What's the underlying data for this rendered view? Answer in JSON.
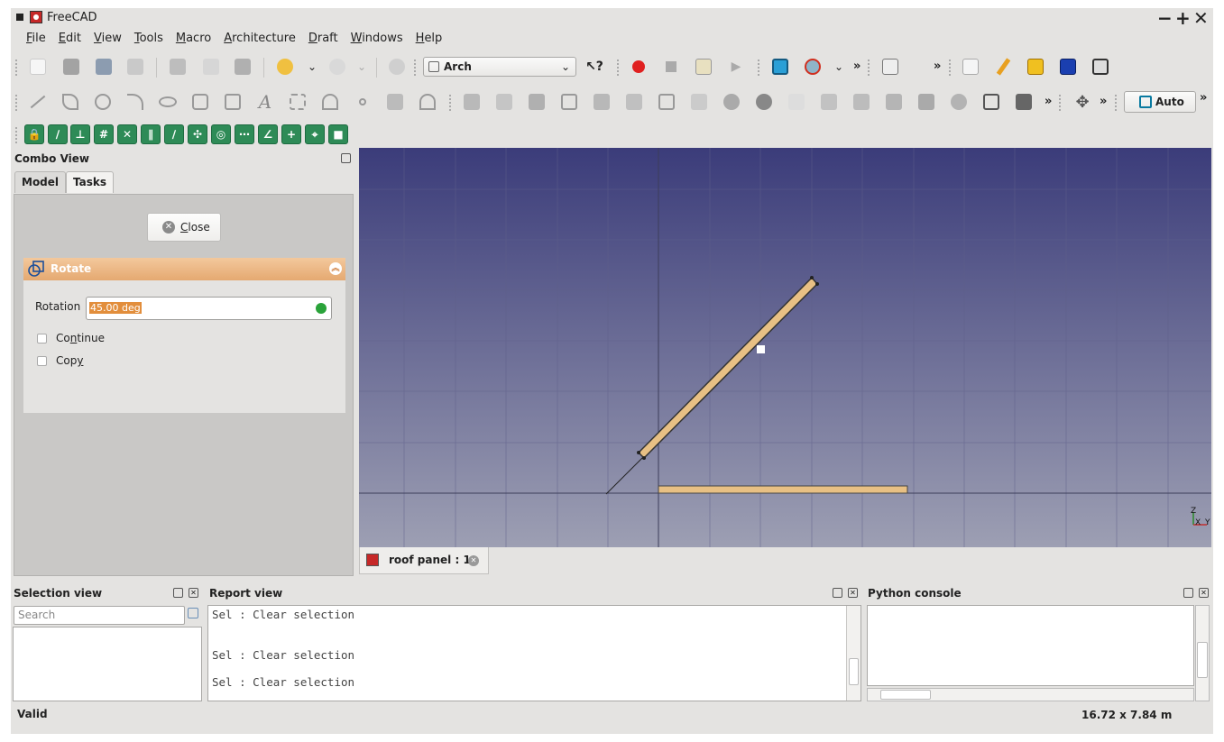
{
  "window": {
    "title": "FreeCAD",
    "controls": [
      "−",
      "+",
      "✕"
    ]
  },
  "menubar": [
    {
      "label": "File",
      "u": "F",
      "rest": "ile"
    },
    {
      "label": "Edit",
      "u": "E",
      "rest": "dit"
    },
    {
      "label": "View",
      "u": "V",
      "rest": "iew"
    },
    {
      "label": "Tools",
      "u": "T",
      "rest": "ools"
    },
    {
      "label": "Macro",
      "u": "M",
      "rest": "acro"
    },
    {
      "label": "Architecture",
      "u": "A",
      "rest": "rchitecture"
    },
    {
      "label": "Draft",
      "u": "D",
      "rest": "raft"
    },
    {
      "label": "Windows",
      "u": "W",
      "rest": "indows"
    },
    {
      "label": "Help",
      "u": "H",
      "rest": "elp"
    }
  ],
  "toolbar": {
    "workbench": "Arch",
    "workbench_arrow": "⌄",
    "auto_label": "Auto",
    "overflow": "»"
  },
  "combo_view": {
    "title": "Combo View",
    "tabs": [
      {
        "label": "Model",
        "active": false
      },
      {
        "label": "Tasks",
        "active": true
      }
    ],
    "close_label": "Close",
    "close_mnemonic": "C",
    "close_rest": "lose"
  },
  "rotate_panel": {
    "title": "Rotate",
    "rotation_label": "Rotation",
    "rotation_value": "45.00 deg",
    "checkboxes": [
      {
        "label": "Continue",
        "u": "n",
        "pre": "Co",
        "post": "tinue",
        "checked": false
      },
      {
        "label": "Copy",
        "u": "y",
        "pre": "Cop",
        "post": "",
        "checked": false
      }
    ]
  },
  "viewport": {
    "document_tab": "roof panel : 1*",
    "axis_labels": [
      "Z",
      "X",
      "Y"
    ]
  },
  "selection_view": {
    "title": "Selection view",
    "search_placeholder": "Search"
  },
  "report_view": {
    "title": "Report view",
    "lines": [
      "Sel : Clear selection",
      "Sel : Clear selection",
      "Sel : Clear selection"
    ]
  },
  "python_console": {
    "title": "Python console"
  },
  "statusbar": {
    "left": "Valid",
    "right": "16.72 x 7.84 m"
  },
  "colors": {
    "panel_orange": "#e5a971",
    "beam": "#e8c084",
    "viewport_top": "#3b3c7a",
    "viewport_bottom": "#9d9fb3"
  }
}
